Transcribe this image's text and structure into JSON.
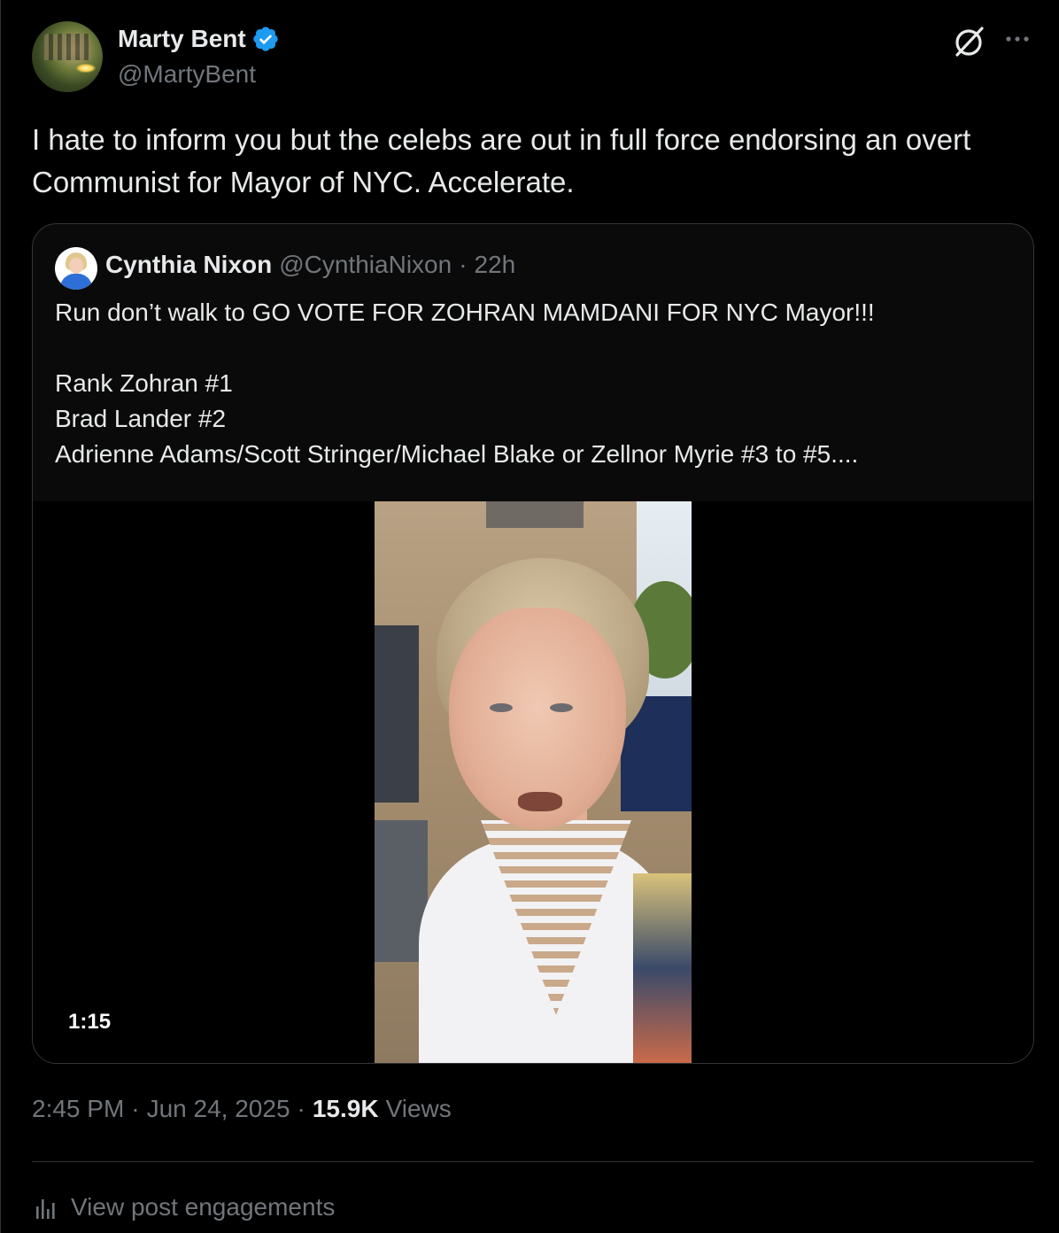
{
  "author": {
    "name": "Marty Bent",
    "handle": "@MartyBent",
    "verified": true
  },
  "tweet": {
    "text": "I hate to inform you but the celebs are out in full force endorsing an overt Communist for Mayor of NYC. Accelerate."
  },
  "quote": {
    "name": "Cynthia Nixon",
    "handle": "@CynthiaNixon",
    "separator": "·",
    "time": "22h",
    "text": "Run don’t walk to GO VOTE FOR ZOHRAN MAMDANI FOR NYC Mayor!!!\n\nRank Zohran #1\nBrad Lander #2\nAdrienne Adams/Scott Stringer/Michael Blake or Zellnor Myrie #3 to #5....",
    "video_duration": "1:15"
  },
  "meta": {
    "time": "2:45 PM",
    "sep1": "·",
    "date": "Jun 24, 2025",
    "sep2": "·",
    "views_count": "15.9K",
    "views_label": "Views"
  },
  "engagements": {
    "label": "View post engagements"
  },
  "colors": {
    "background": "#000000",
    "text": "#e7e9ea",
    "muted": "#71767b",
    "verified": "#1d9bf0",
    "border": "#2f3336"
  },
  "icons": [
    "verified-icon",
    "grok-icon",
    "more-icon",
    "bar-chart-icon"
  ]
}
